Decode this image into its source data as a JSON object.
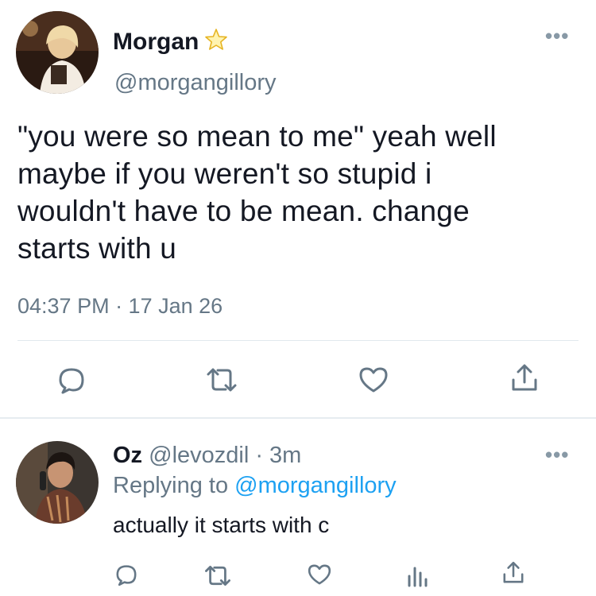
{
  "tweet": {
    "author_name": "Morgan",
    "author_handle": "@morgangillory",
    "badge_icon": "star-icon",
    "text_lines": [
      "\"you were so mean to me\" yeah well",
      "maybe if you weren't so stupid i",
      "wouldn't have to be mean. change",
      "starts with u"
    ],
    "timestamp": "04:37 PM · 17 Jan 26",
    "actions": [
      "reply-icon",
      "retweet-icon",
      "like-icon",
      "share-icon"
    ],
    "more_label": "•••"
  },
  "reply": {
    "author_name": "Oz",
    "author_handle": "@levozdil",
    "age": "· 3m",
    "replying_prefix": "Replying to",
    "replying_to": "@morgangillory",
    "text": "actually it starts with c",
    "actions": [
      "reply-icon",
      "retweet-icon",
      "like-icon",
      "analytics-icon",
      "share-icon"
    ],
    "more_label": "•••"
  },
  "colors": {
    "text": "#141823",
    "secondary": "#657786",
    "link": "#1da1f2",
    "star": "#f5c518",
    "icon": "#657786"
  }
}
